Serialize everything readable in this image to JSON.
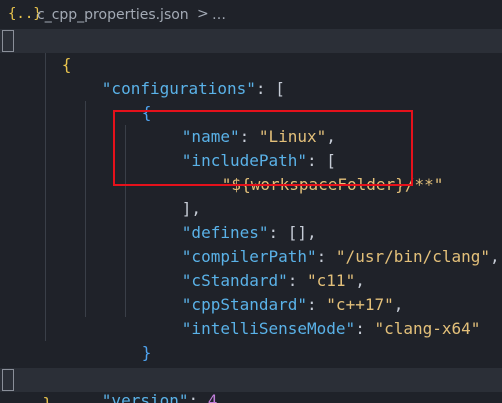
{
  "breadcrumb": {
    "icon": "json-braces-icon",
    "file": "c_cpp_properties.json",
    "separator": ">",
    "ellipsis": "…"
  },
  "colors": {
    "background": "#1f2229",
    "key": "#5ab2e8",
    "string": "#e3c07a",
    "number": "#c07ed8",
    "punctuation": "#c6ccd6",
    "highlight_box": "#e5111b"
  },
  "code": {
    "l1_open": "{",
    "l2_key": "\"configurations\"",
    "l2_punc": ": [",
    "l3_open": "{",
    "l4_key": "\"name\"",
    "l4_colon": ": ",
    "l4_val": "\"Linux\"",
    "l4_comma": ",",
    "l5_key": "\"includePath\"",
    "l5_punc": ": [",
    "l6_val": "\"${workspaceFolder}/**\"",
    "l7_punc": "],",
    "l8_key": "\"defines\"",
    "l8_punc": ": [],",
    "l9_key": "\"compilerPath\"",
    "l9_colon": ": ",
    "l9_val": "\"/usr/bin/clang\"",
    "l9_comma": ",",
    "l10_key": "\"cStandard\"",
    "l10_colon": ": ",
    "l10_val": "\"c11\"",
    "l10_comma": ",",
    "l11_key": "\"cppStandard\"",
    "l11_colon": ": ",
    "l11_val": "\"c++17\"",
    "l11_comma": ",",
    "l12_key": "\"intelliSenseMode\"",
    "l12_colon": ": ",
    "l12_val": "\"clang-x64\"",
    "l13_close": "}",
    "l14_close": "],",
    "l15_key": "\"version\"",
    "l15_colon": ": ",
    "l15_val": "4",
    "l16_close": "}"
  }
}
